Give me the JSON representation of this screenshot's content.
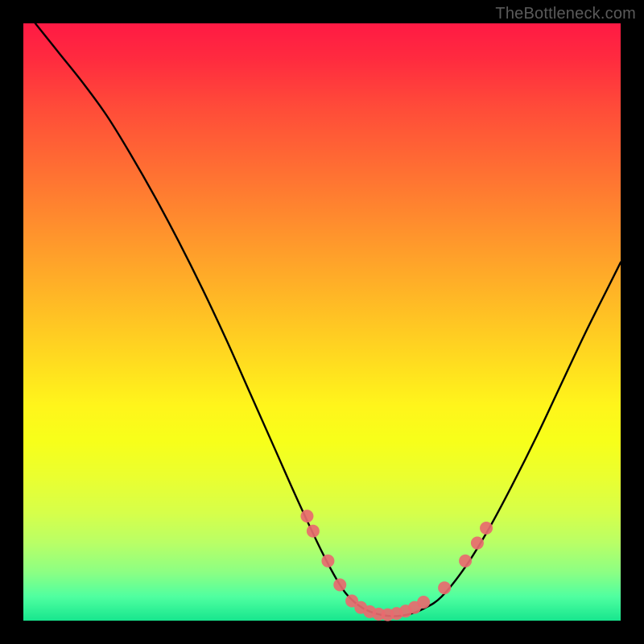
{
  "watermark": "TheBottleneck.com",
  "colors": {
    "page_bg": "#000000",
    "curve_stroke": "#000000",
    "marker_fill": "#e86a6f",
    "marker_stroke": "#e86a6f"
  },
  "chart_data": {
    "type": "line",
    "title": "",
    "xlabel": "",
    "ylabel": "",
    "xlim": [
      0,
      100
    ],
    "ylim": [
      0,
      100
    ],
    "grid": false,
    "legend": false,
    "comment": "Bottleneck-style V-curve. x is normalized position across plot width, y is normalized height (0 at bottom, 100 at top). Values are read off the rendered curve; no axes are labeled in the source image.",
    "series": [
      {
        "name": "curve",
        "x": [
          2,
          6,
          10,
          14,
          18,
          22,
          26,
          30,
          34,
          38,
          42,
          46,
          50,
          53,
          55,
          57,
          59,
          61,
          63,
          65,
          67,
          70,
          74,
          78,
          82,
          86,
          90,
          94,
          98,
          100
        ],
        "y": [
          100,
          95,
          90,
          84.5,
          78,
          71,
          63.5,
          55.5,
          47,
          38,
          29,
          20,
          11.5,
          6,
          3.5,
          2,
          1.2,
          0.8,
          0.8,
          1.2,
          2,
          4,
          9,
          15.5,
          23,
          31,
          39.5,
          48,
          56,
          60
        ]
      }
    ],
    "markers": {
      "comment": "Pink circular markers clustered near the valley of the curve, roughly along the curve itself.",
      "points": [
        {
          "x": 47.5,
          "y": 17.5
        },
        {
          "x": 48.5,
          "y": 15
        },
        {
          "x": 51,
          "y": 10
        },
        {
          "x": 53,
          "y": 6
        },
        {
          "x": 55,
          "y": 3.3
        },
        {
          "x": 56.5,
          "y": 2.2
        },
        {
          "x": 58,
          "y": 1.5
        },
        {
          "x": 59.5,
          "y": 1.1
        },
        {
          "x": 61,
          "y": 1.0
        },
        {
          "x": 62.5,
          "y": 1.2
        },
        {
          "x": 64,
          "y": 1.6
        },
        {
          "x": 65.5,
          "y": 2.2
        },
        {
          "x": 67,
          "y": 3.1
        },
        {
          "x": 70.5,
          "y": 5.5
        },
        {
          "x": 74,
          "y": 10
        },
        {
          "x": 76,
          "y": 13
        },
        {
          "x": 77.5,
          "y": 15.5
        }
      ],
      "radius_px": 8
    }
  }
}
